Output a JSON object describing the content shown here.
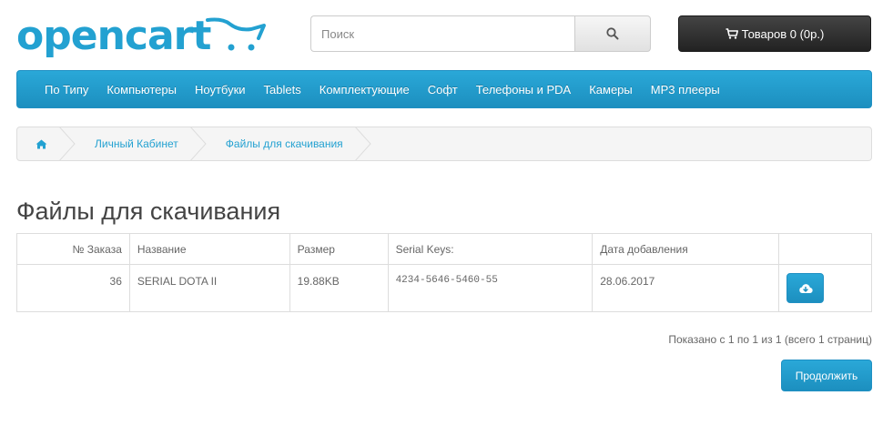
{
  "header": {
    "logo_text": "opencart",
    "search_placeholder": "Поиск",
    "cart_label": "Товаров 0 (0р.)",
    "brand_color": "#23a1d1"
  },
  "menu": {
    "items": [
      "По Типу",
      "Компьютеры",
      "Ноутбуки",
      "Tablets",
      "Комплектующие",
      "Софт",
      "Телефоны и PDA",
      "Камеры",
      "MP3 плееры"
    ]
  },
  "breadcrumb": {
    "home_icon": "home-icon",
    "items": [
      "Личный Кабинет",
      "Файлы для скачивания"
    ]
  },
  "page": {
    "title": "Файлы для скачивания"
  },
  "table": {
    "headers": [
      "№ Заказа",
      "Название",
      "Размер",
      "Serial Keys:",
      "Дата добавления",
      ""
    ],
    "rows": [
      {
        "order": "36",
        "name": "SERIAL DOTA II",
        "size": "19.88KB",
        "serial": "4234-5646-5460-55",
        "date": "28.06.2017",
        "action_icon": "cloud-download-icon"
      }
    ]
  },
  "pagination": {
    "text": "Показано с 1 по 1 из 1 (всего 1 страниц)"
  },
  "actions": {
    "continue_label": "Продолжить"
  }
}
